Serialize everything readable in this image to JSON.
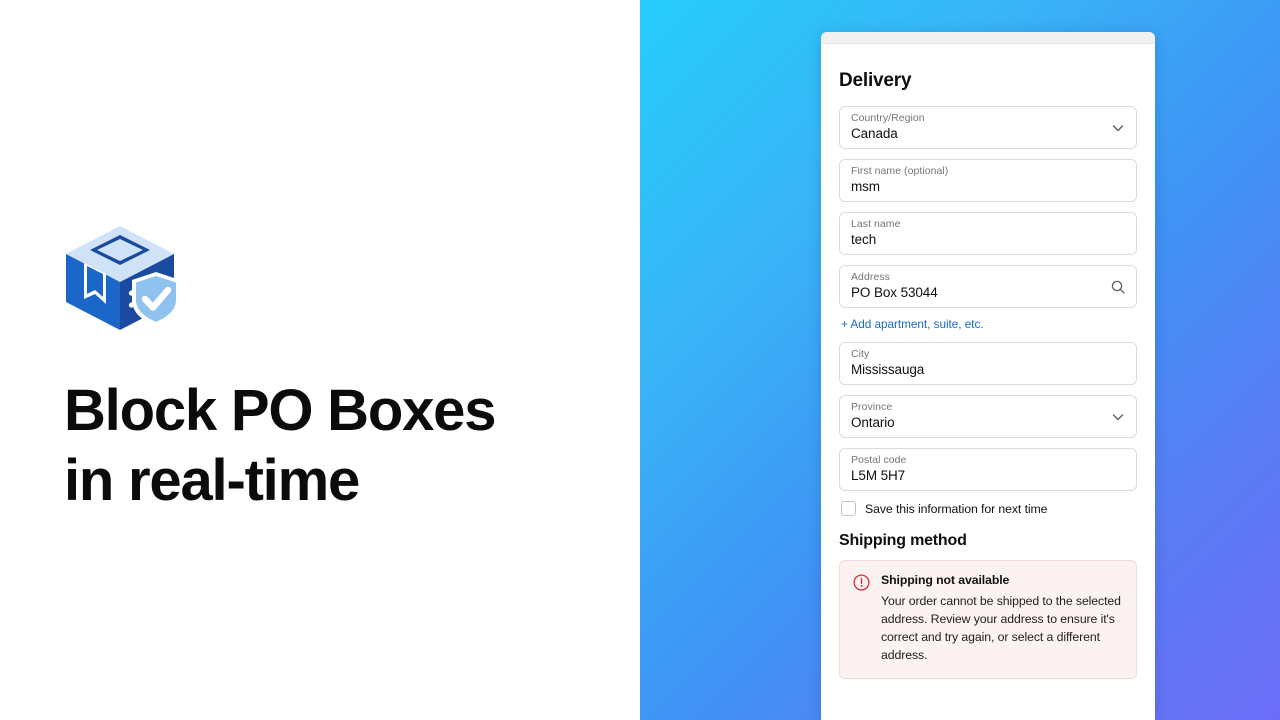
{
  "marketing": {
    "logo_name": "shielded-package-logo",
    "headline": "Block PO Boxes\nin real-time",
    "logo_colors": {
      "top_face": "#cfe2f8",
      "left_face": "#1a66c9",
      "right_face": "#1b4ba0",
      "shield": "#8fc2ef",
      "check": "#ffffff"
    }
  },
  "background": {
    "gradient_from": "#26cdfb",
    "gradient_to": "#6d6ef8"
  },
  "checkout": {
    "delivery": {
      "title": "Delivery",
      "fields": [
        {
          "label": "Country/Region",
          "value": "Canada",
          "icon": "chevron-down-icon",
          "name": "country-region"
        },
        {
          "label": "First name (optional)",
          "value": "msm",
          "icon": "",
          "name": "first-name"
        },
        {
          "label": "Last name",
          "value": "tech",
          "icon": "",
          "name": "last-name"
        },
        {
          "label": "Address",
          "value": "PO Box 53044",
          "icon": "search-icon",
          "name": "address"
        },
        {
          "label": "City",
          "value": "Mississauga",
          "icon": "",
          "name": "city"
        },
        {
          "label": "Province",
          "value": "Ontario",
          "icon": "chevron-down-icon",
          "name": "province"
        },
        {
          "label": "Postal code",
          "value": "L5M 5H7",
          "icon": "",
          "name": "postal-code"
        }
      ],
      "add_apartment_link": "+ Add apartment, suite, etc.",
      "link_color": "#1b6ac4",
      "save_info_label": "Save this information for next time",
      "save_info_checked": false
    },
    "shipping": {
      "title": "Shipping method",
      "alert": {
        "icon": "error-circle-icon",
        "icon_color": "#d82c2c",
        "background": "#fdf2f2",
        "title": "Shipping not available",
        "body": "Your order cannot be shipped to the selected address. Review your address to ensure it's correct and try again, or select a different address."
      }
    }
  }
}
